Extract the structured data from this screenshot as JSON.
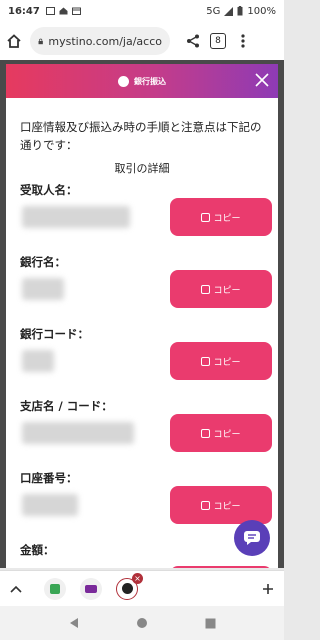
{
  "status": {
    "time": "16:47",
    "network": "5G",
    "battery": "100%"
  },
  "browser": {
    "url": "mystino.com/ja/acco",
    "tab_count": "8"
  },
  "modal": {
    "title": "銀行振込",
    "intro": "口座情報及び振込み時の手順と注意点は下記の通りです：",
    "detail_title": "取引の詳細",
    "copy_label": "コピー",
    "fields": [
      {
        "label": "受取人名："
      },
      {
        "label": "銀行名："
      },
      {
        "label": "銀行コード："
      },
      {
        "label": "支店名 / コード："
      },
      {
        "label": "口座番号："
      },
      {
        "label": "金額："
      }
    ]
  },
  "colors": {
    "accent": "#ea3b6e",
    "header_start": "#e63a5f",
    "header_end": "#8e3bb5",
    "chat": "#5a3fb8"
  }
}
